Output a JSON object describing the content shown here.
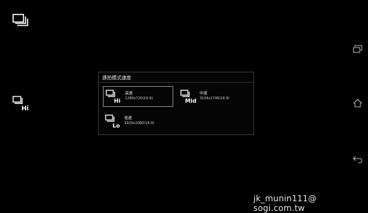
{
  "left_icons": {
    "top_icon": "burst-mode-icon",
    "hi_icon": "burst-hi-icon",
    "hi_badge": "Hi"
  },
  "dialog": {
    "title": "連拍模式速度",
    "options": [
      {
        "badge": "Hi",
        "label": "高速",
        "resolution": "1280x720(16:9)",
        "selected": true
      },
      {
        "badge": "Mid",
        "label": "中速",
        "resolution": "3104x1746(16:9)",
        "selected": false
      },
      {
        "badge": "Lo",
        "label": "低速",
        "resolution": "1920x1080(16:9)",
        "selected": false
      }
    ]
  },
  "nav": {
    "recent_icon": "recent-apps-icon",
    "home_icon": "home-icon",
    "back_icon": "back-icon"
  },
  "watermark": "jk_munin111@ sogi.com.tw"
}
